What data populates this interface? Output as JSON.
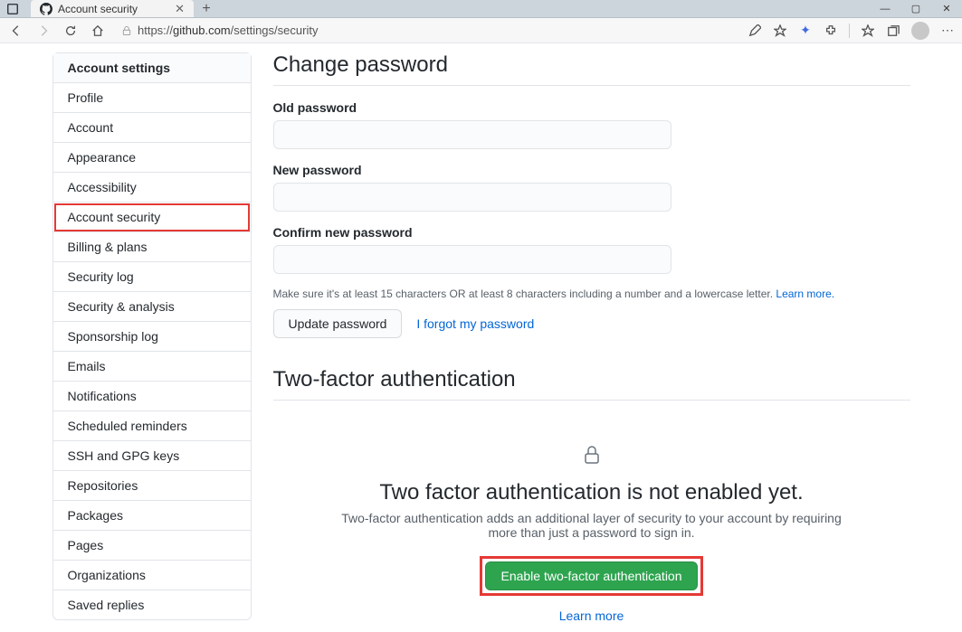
{
  "browser": {
    "tab_title": "Account security",
    "url_scheme": "https://",
    "url_host": "github.com",
    "url_path": "/settings/security"
  },
  "sidebar": {
    "heading": "Account settings",
    "items": [
      {
        "label": "Profile"
      },
      {
        "label": "Account"
      },
      {
        "label": "Appearance"
      },
      {
        "label": "Accessibility"
      },
      {
        "label": "Account security"
      },
      {
        "label": "Billing & plans"
      },
      {
        "label": "Security log"
      },
      {
        "label": "Security & analysis"
      },
      {
        "label": "Sponsorship log"
      },
      {
        "label": "Emails"
      },
      {
        "label": "Notifications"
      },
      {
        "label": "Scheduled reminders"
      },
      {
        "label": "SSH and GPG keys"
      },
      {
        "label": "Repositories"
      },
      {
        "label": "Packages"
      },
      {
        "label": "Pages"
      },
      {
        "label": "Organizations"
      },
      {
        "label": "Saved replies"
      }
    ]
  },
  "password_section": {
    "title": "Change password",
    "old_label": "Old password",
    "new_label": "New password",
    "confirm_label": "Confirm new password",
    "note_text": "Make sure it's at least 15 characters OR at least 8 characters including a number and a lowercase letter. ",
    "note_link": "Learn more.",
    "update_btn": "Update password",
    "forgot_link": "I forgot my password"
  },
  "tfa_section": {
    "title": "Two-factor authentication",
    "heading": "Two factor authentication is not enabled yet.",
    "subtext": "Two-factor authentication adds an additional layer of security to your account by requiring more than just a password to sign in.",
    "enable_btn": "Enable two-factor authentication",
    "learn_more": "Learn more"
  }
}
